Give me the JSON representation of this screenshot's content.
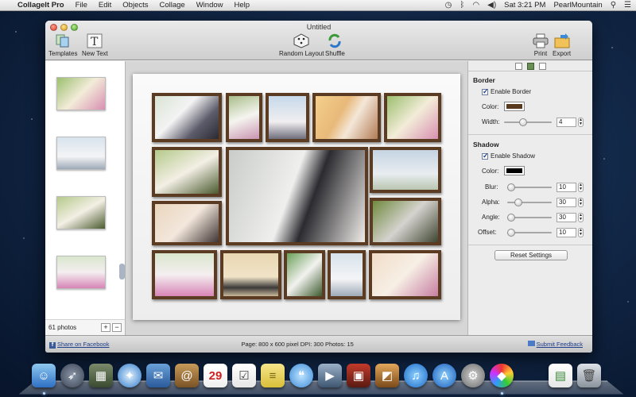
{
  "menubar": {
    "app_name": "CollageIt Pro",
    "menus": [
      "File",
      "Edit",
      "Objects",
      "Collage",
      "Window",
      "Help"
    ],
    "clock": "Sat 3:21 PM",
    "user": "PearlMountain"
  },
  "window": {
    "title": "Untitled",
    "toolbar": {
      "templates": "Templates",
      "new_text": "New Text",
      "random_layout": "Random Layout",
      "shuffle": "Shuffle",
      "print": "Print",
      "export": "Export"
    }
  },
  "sidebar": {
    "photo_count": "61 photos",
    "add": "+",
    "remove": "−"
  },
  "panel": {
    "border": {
      "title": "Border",
      "enable_label": "Enable Border",
      "color_label": "Color:",
      "color": "#5a3a1f",
      "width_label": "Width:",
      "width_value": "4"
    },
    "shadow": {
      "title": "Shadow",
      "enable_label": "Enable Shadow",
      "color_label": "Color:",
      "color": "#000000",
      "blur_label": "Blur:",
      "blur_value": "10",
      "alpha_label": "Alpha:",
      "alpha_value": "30",
      "angle_label": "Angle:",
      "angle_value": "30",
      "offset_label": "Offset:",
      "offset_value": "10"
    },
    "reset_button": "Reset Settings"
  },
  "status": {
    "facebook": "Share on Facebook",
    "info": "Page: 800 x 600 pixel DPI: 300 Photos: 15",
    "feedback": "Submit Feedback"
  },
  "colors": {
    "frame": "#5b3c22",
    "accent": "#1f3e8c"
  }
}
